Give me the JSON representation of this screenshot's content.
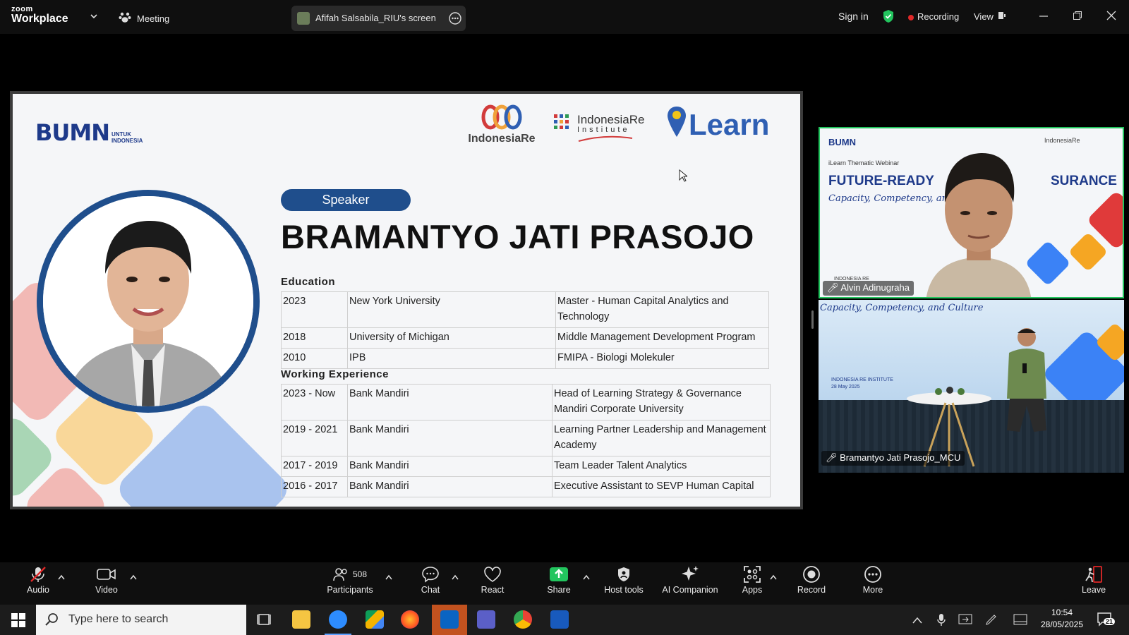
{
  "titlebar": {
    "zoom_brand": "zoom",
    "zoom_product": "Workplace",
    "meeting_label": "Meeting",
    "share_source": "Afifah Salsabila_RIU's screen",
    "sign_in": "Sign in",
    "recording": "Recording",
    "view": "View"
  },
  "slide": {
    "bumn_logo": "BUMN",
    "bumn_sub1": "UNTUK",
    "bumn_sub2": "INDONESIA",
    "logo_indonesiare": "IndonesiaRe",
    "logo_institute_a": "IndonesiaRe",
    "logo_institute_b": "Institute",
    "logo_ilearn": "Learn",
    "speaker_badge": "Speaker",
    "speaker_name": "BRAMANTYO JATI PRASOJO",
    "education_title": "Education",
    "education": [
      {
        "year": "2023",
        "school": "New York University",
        "program": "Master - Human Capital Analytics and Technology"
      },
      {
        "year": "2018",
        "school": "University of Michigan",
        "program": "Middle Management Development Program"
      },
      {
        "year": "2010",
        "school": "IPB",
        "program": "FMIPA - Biologi Molekuler"
      }
    ],
    "experience_title": "Working Experience",
    "experience": [
      {
        "period": "2023 - Now",
        "company": "Bank Mandiri",
        "role": "Head of Learning Strategy & Governance Mandiri Corporate University"
      },
      {
        "period": "2019 - 2021",
        "company": "Bank Mandiri",
        "role": "Learning Partner Leadership and Management Academy"
      },
      {
        "period": "2017 - 2019",
        "company": "Bank Mandiri",
        "role": "Team Leader Talent Analytics"
      },
      {
        "period": "2016 - 2017",
        "company": "Bank Mandiri",
        "role": "Executive Assistant to SEVP Human Capital"
      }
    ]
  },
  "videos": {
    "top": {
      "name": "Alvin Adinugraha",
      "bg_small": "iLearn Thematic Webinar",
      "bg_title_left": "FUTURE-READY",
      "bg_title_right": "SURANCE",
      "bg_script": "Capacity, Competency, and Cu",
      "bg_bumn": "BUMN",
      "bg_indonesiare": "IndonesiaRe",
      "bg_indonesiare_badge": "INDONESIA RE"
    },
    "bottom": {
      "name": "Bramantyo Jati Prasojo_MCU",
      "bg_script": "Capacity, Competency, and Culture",
      "bg_institute": "INDONESIA RE INSTITUTE",
      "bg_date": "28 May 2025"
    }
  },
  "toolbar": {
    "audio": "Audio",
    "video": "Video",
    "participants_count": "508",
    "participants": "Participants",
    "chat": "Chat",
    "react": "React",
    "share": "Share",
    "host_tools": "Host tools",
    "ai_companion": "AI Companion",
    "apps": "Apps",
    "record": "Record",
    "more": "More",
    "leave": "Leave"
  },
  "taskbar": {
    "search_placeholder": "Type here to search",
    "time": "10:54",
    "date": "28/05/2025",
    "notifications": "21"
  },
  "colors": {
    "accent_blue": "#1f4e8c",
    "share_green": "#22c55e",
    "recording_red": "#e02828",
    "active_speaker_border": "#22c55e"
  }
}
